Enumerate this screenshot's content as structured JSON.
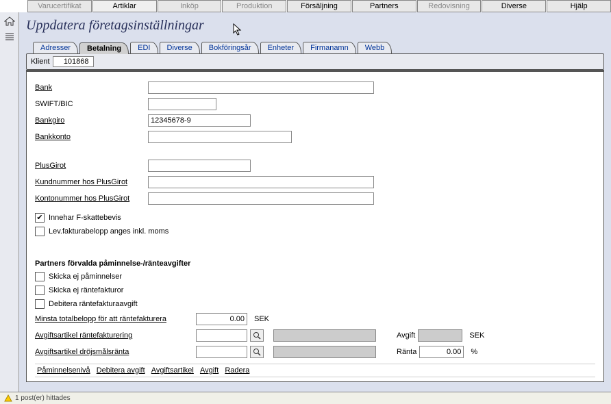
{
  "menu": {
    "items": [
      {
        "label": "Varucertifikat",
        "disabled": true
      },
      {
        "label": "Artiklar",
        "disabled": false
      },
      {
        "label": "Inköp",
        "disabled": true
      },
      {
        "label": "Produktion",
        "disabled": true
      },
      {
        "label": "Försäljning",
        "disabled": false
      },
      {
        "label": "Partners",
        "disabled": false
      },
      {
        "label": "Redovisning",
        "disabled": true
      },
      {
        "label": "Diverse",
        "disabled": false
      },
      {
        "label": "Hjälp",
        "disabled": false
      }
    ]
  },
  "page_title": "Uppdatera företagsinställningar",
  "tabs": [
    {
      "label": "Adresser"
    },
    {
      "label": "Betalning",
      "active": true
    },
    {
      "label": "EDI"
    },
    {
      "label": "Diverse"
    },
    {
      "label": "Bokföringsår"
    },
    {
      "label": "Enheter"
    },
    {
      "label": "Firmanamn"
    },
    {
      "label": "Webb"
    }
  ],
  "klient": {
    "label": "Klient",
    "value": "101868"
  },
  "form": {
    "bank": {
      "label": "Bank",
      "value": ""
    },
    "swift": {
      "label": "SWIFT/BIC",
      "value": ""
    },
    "bankgiro": {
      "label": "Bankgiro",
      "value": "12345678-9"
    },
    "bankkonto": {
      "label": "Bankkonto",
      "value": ""
    },
    "plusgirot": {
      "label": "PlusGirot",
      "value": ""
    },
    "kundnummer": {
      "label": "Kundnummer hos PlusGirot",
      "value": ""
    },
    "kontonummer": {
      "label": "Kontonummer hos PlusGirot",
      "value": ""
    },
    "fskatt": {
      "label": "Innehar F-skattebevis",
      "checked": true
    },
    "levfaktura": {
      "label": "Lev.fakturabelopp anges inkl. moms",
      "checked": false
    }
  },
  "partners_section": {
    "header": "Partners förvalda påminnelse-/ränteavgifter",
    "skicka_paminnelser": {
      "label": "Skicka ej påminnelser",
      "checked": false
    },
    "skicka_rantefakturor": {
      "label": "Skicka ej räntefakturor",
      "checked": false
    },
    "debitera": {
      "label": "Debitera räntefakturaavgift",
      "checked": false
    },
    "minsta": {
      "label": "Minsta totalbelopp för att räntefakturera",
      "value": "0.00",
      "unit": "SEK"
    },
    "avgiftsartikel_rf": {
      "label": "Avgiftsartikel räntefakturering",
      "value": ""
    },
    "avgiftsartikel_dr": {
      "label": "Avgiftsartikel dröjsmålsränta",
      "value": ""
    },
    "avgift": {
      "label": "Avgift",
      "value": "",
      "unit": "SEK"
    },
    "ranta": {
      "label": "Ränta",
      "value": "0.00",
      "unit": "%"
    }
  },
  "footer_cols": [
    "Påminnelsenivå",
    "Debitera avgift",
    "Avgiftsartikel",
    "Avgift",
    "Radera"
  ],
  "status": "1 post(er) hittades"
}
